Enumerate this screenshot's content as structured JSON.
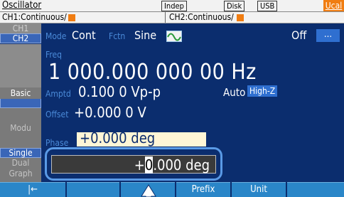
{
  "titlebar": {
    "title": "Oscillator",
    "indep": "Indep",
    "disk": "Disk",
    "usb": "USB",
    "ucal": "Ucal"
  },
  "channels": {
    "ch1": "CH1:Continuous/",
    "ch2": "CH2:Continuous/"
  },
  "tabs": {
    "ch1": "CH1",
    "ch2": "CH2",
    "basic": "Basic",
    "modu": "Modu",
    "single": "Single",
    "dual": "Dual",
    "graph": "Graph"
  },
  "mode": {
    "label": "Mode",
    "value": "Cont",
    "fctn_label": "Fctn",
    "fctn_value": "Sine",
    "output": "Off",
    "more": "..."
  },
  "freq": {
    "label": "Freq",
    "value": "1 000.000 000 00 Hz"
  },
  "amptd": {
    "label": "Amptd",
    "value": "0.100 0 Vp-p",
    "auto": "Auto",
    "impedance": "High-Z"
  },
  "offset": {
    "label": "Offset",
    "value": "+0.000 0 V"
  },
  "phase": {
    "label": "Phase",
    "value": "+0.000 deg"
  },
  "editor": {
    "sign": "+",
    "cursor_digit": "0",
    "rest": ".000 deg"
  },
  "bottom": {
    "back": "|←",
    "prefix": "Prefix",
    "unit": "Unit"
  },
  "colors": {
    "background": "#0b2d6e",
    "accent": "#f07d12",
    "label": "#4a8ad8",
    "highlight": "#2f6fd0"
  }
}
